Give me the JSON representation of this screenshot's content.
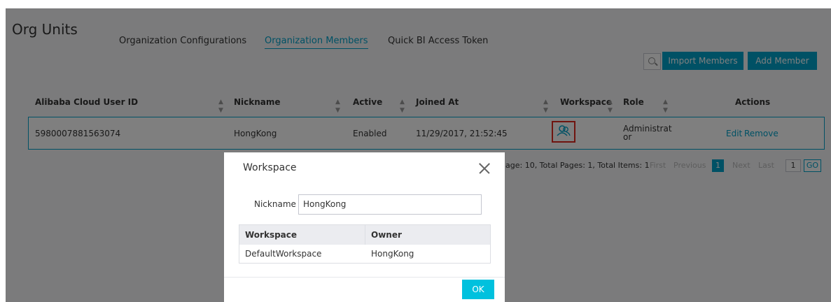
{
  "header": {
    "title": "Org Units",
    "tabs": [
      {
        "label": "Organization Configurations",
        "active": false
      },
      {
        "label": "Organization Members",
        "active": true
      },
      {
        "label": "Quick BI Access Token",
        "active": false
      }
    ]
  },
  "toolbar": {
    "search_icon": "search-icon",
    "import_label": "Import Members",
    "add_label": "Add Member"
  },
  "table": {
    "columns": [
      "Alibaba Cloud User ID",
      "Nickname",
      "Active",
      "Joined At",
      "Workspace",
      "Role",
      "Actions"
    ],
    "rows": [
      {
        "user_id": "5980007881563074",
        "nickname": "HongKong",
        "active": "Enabled",
        "joined_at": "11/29/2017, 21:52:45",
        "workspace_icon": "members-icon",
        "role_line1": "Administrat",
        "role_line2": "or",
        "edit": "Edit",
        "remove": "Remove"
      }
    ]
  },
  "pagination": {
    "summary": "age: 10, Total Pages: 1, Total Items: 1",
    "first": "First",
    "previous": "Previous",
    "current": "1",
    "next": "Next",
    "last": "Last",
    "page_input": "1",
    "go": "GO"
  },
  "modal": {
    "title": "Workspace",
    "nickname_label": "Nickname",
    "nickname_value": "HongKong",
    "columns": [
      "Workspace",
      "Owner"
    ],
    "rows": [
      {
        "workspace": "DefaultWorkspace",
        "owner": "HongKong"
      }
    ],
    "ok_label": "OK"
  },
  "colors": {
    "accent": "#00a2ca",
    "ok_button": "#00c1de",
    "highlight_border": "#e0291f"
  }
}
